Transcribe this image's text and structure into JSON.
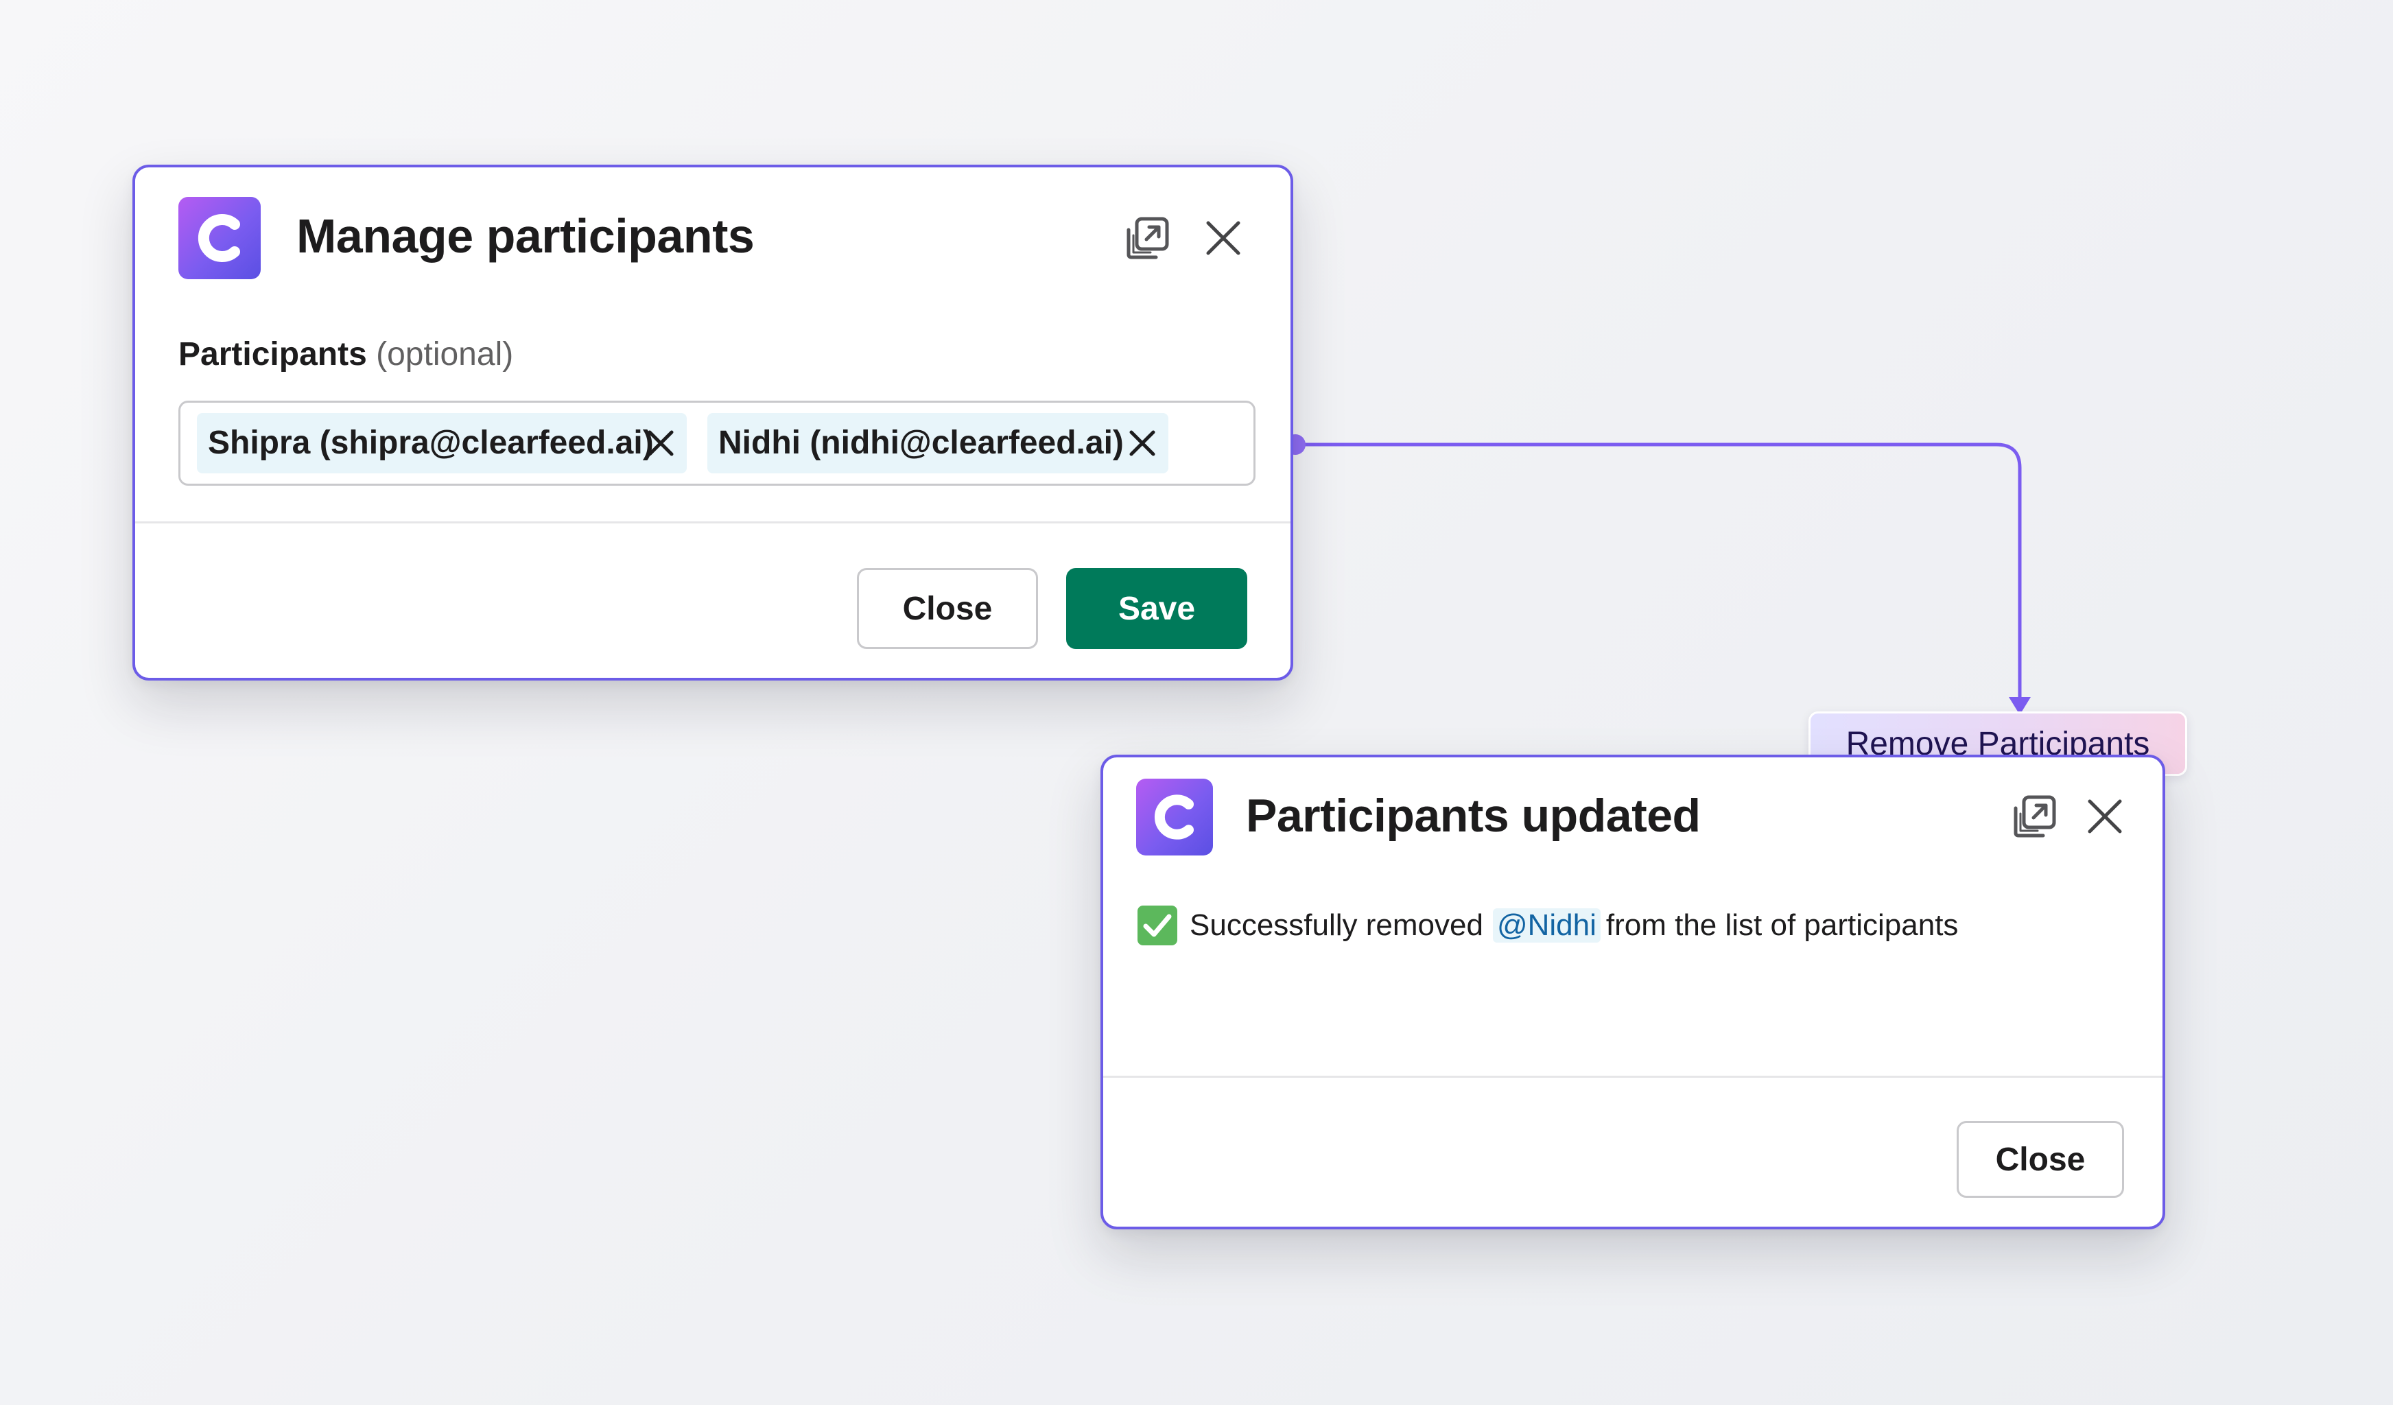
{
  "manage_modal": {
    "title": "Manage participants",
    "field_label": "Participants",
    "field_optional": "(optional)",
    "chips": [
      {
        "label": "Shipra (shipra@clearfeed.ai)"
      },
      {
        "label": "Nidhi (nidhi@clearfeed.ai)"
      }
    ],
    "close_label": "Close",
    "save_label": "Save"
  },
  "flow_tag": {
    "label": "Remove Participants"
  },
  "updated_modal": {
    "title": "Participants updated",
    "message_before": "Successfully removed",
    "mention": "@Nidhi",
    "message_after": "from the list of participants",
    "close_label": "Close"
  },
  "icons": {
    "app_logo": "clearfeed-logo-icon",
    "popout": "popout-icon",
    "close": "close-icon",
    "chip_remove": "remove-chip-icon",
    "success": "check-mark-icon"
  },
  "colors": {
    "modal_border": "#6c5ce7",
    "primary_button": "#007a5a",
    "chip_background": "#e8f5fa",
    "mention_text": "#1264a3",
    "connector": "#7b5cf0"
  }
}
